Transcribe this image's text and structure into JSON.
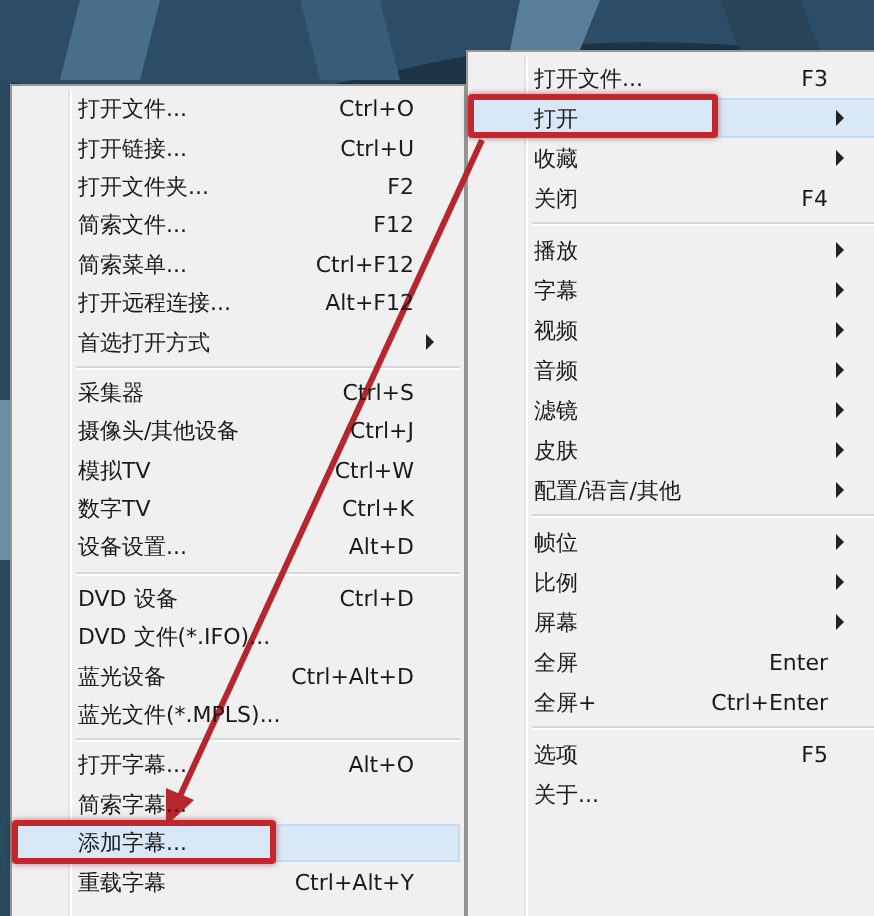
{
  "menus": [
    {
      "kind": "submenu",
      "items": [
        {
          "kind": "item",
          "label": "打开文件...",
          "shortcut": "Ctrl+O",
          "submenu": false,
          "selected": false,
          "annotated": false
        },
        {
          "kind": "item",
          "label": "打开链接...",
          "shortcut": "Ctrl+U",
          "submenu": false,
          "selected": false,
          "annotated": false
        },
        {
          "kind": "item",
          "label": "打开文件夹...",
          "shortcut": "F2",
          "submenu": false,
          "selected": false,
          "annotated": false
        },
        {
          "kind": "item",
          "label": "简索文件...",
          "shortcut": "F12",
          "submenu": false,
          "selected": false,
          "annotated": false
        },
        {
          "kind": "item",
          "label": "简索菜单...",
          "shortcut": "Ctrl+F12",
          "submenu": false,
          "selected": false,
          "annotated": false
        },
        {
          "kind": "item",
          "label": "打开远程连接...",
          "shortcut": "Alt+F12",
          "submenu": false,
          "selected": false,
          "annotated": false
        },
        {
          "kind": "item",
          "label": "首选打开方式",
          "submenu": true,
          "selected": false,
          "annotated": false
        },
        {
          "kind": "separator"
        },
        {
          "kind": "item",
          "label": "采集器",
          "shortcut": "Ctrl+S",
          "submenu": false,
          "selected": false,
          "annotated": false
        },
        {
          "kind": "item",
          "label": "摄像头/其他设备",
          "shortcut": "Ctrl+J",
          "submenu": false,
          "selected": false,
          "annotated": false
        },
        {
          "kind": "item",
          "label": "模拟TV",
          "shortcut": "Ctrl+W",
          "submenu": false,
          "selected": false,
          "annotated": false
        },
        {
          "kind": "item",
          "label": "数字TV",
          "shortcut": "Ctrl+K",
          "submenu": false,
          "selected": false,
          "annotated": false
        },
        {
          "kind": "item",
          "label": "设备设置...",
          "shortcut": "Alt+D",
          "submenu": false,
          "selected": false,
          "annotated": false
        },
        {
          "kind": "separator"
        },
        {
          "kind": "item",
          "label": "DVD 设备",
          "shortcut": "Ctrl+D",
          "submenu": false,
          "selected": false,
          "annotated": false
        },
        {
          "kind": "item",
          "label": "DVD 文件(*.IFO)...",
          "submenu": false,
          "selected": false,
          "annotated": false
        },
        {
          "kind": "item",
          "label": "蓝光设备",
          "shortcut": "Ctrl+Alt+D",
          "submenu": false,
          "selected": false,
          "annotated": false
        },
        {
          "kind": "item",
          "label": "蓝光文件(*.MPLS)...",
          "submenu": false,
          "selected": false,
          "annotated": false
        },
        {
          "kind": "separator"
        },
        {
          "kind": "item",
          "label": "打开字幕...",
          "shortcut": "Alt+O",
          "submenu": false,
          "selected": false,
          "annotated": false
        },
        {
          "kind": "item",
          "label": "简索字幕...",
          "submenu": false,
          "selected": false,
          "annotated": false
        },
        {
          "kind": "item",
          "label": "添加字幕...",
          "submenu": false,
          "selected": true,
          "annotated": true
        },
        {
          "kind": "item",
          "label": "重载字幕",
          "shortcut": "Ctrl+Alt+Y",
          "submenu": false,
          "selected": false,
          "annotated": false
        }
      ]
    },
    {
      "kind": "main",
      "items": [
        {
          "kind": "item",
          "label": "打开文件...",
          "shortcut": "F3",
          "submenu": false,
          "selected": false,
          "annotated": false
        },
        {
          "kind": "item",
          "label": "打开",
          "submenu": true,
          "selected": true,
          "annotated": true
        },
        {
          "kind": "item",
          "label": "收藏",
          "submenu": true,
          "selected": false,
          "annotated": false
        },
        {
          "kind": "item",
          "label": "关闭",
          "shortcut": "F4",
          "submenu": false,
          "selected": false,
          "annotated": false
        },
        {
          "kind": "separator"
        },
        {
          "kind": "item",
          "label": "播放",
          "submenu": true,
          "selected": false,
          "annotated": false
        },
        {
          "kind": "item",
          "label": "字幕",
          "submenu": true,
          "selected": false,
          "annotated": false
        },
        {
          "kind": "item",
          "label": "视频",
          "submenu": true,
          "selected": false,
          "annotated": false
        },
        {
          "kind": "item",
          "label": "音频",
          "submenu": true,
          "selected": false,
          "annotated": false
        },
        {
          "kind": "item",
          "label": "滤镜",
          "submenu": true,
          "selected": false,
          "annotated": false
        },
        {
          "kind": "item",
          "label": "皮肤",
          "submenu": true,
          "selected": false,
          "annotated": false
        },
        {
          "kind": "item",
          "label": "配置/语言/其他",
          "submenu": true,
          "selected": false,
          "annotated": false
        },
        {
          "kind": "separator"
        },
        {
          "kind": "item",
          "label": "帧位",
          "submenu": true,
          "selected": false,
          "annotated": false
        },
        {
          "kind": "item",
          "label": "比例",
          "submenu": true,
          "selected": false,
          "annotated": false
        },
        {
          "kind": "item",
          "label": "屏幕",
          "submenu": true,
          "selected": false,
          "annotated": false
        },
        {
          "kind": "item",
          "label": "全屏",
          "shortcut": "Enter",
          "submenu": false,
          "selected": false,
          "annotated": false
        },
        {
          "kind": "item",
          "label": "全屏+",
          "shortcut": "Ctrl+Enter",
          "submenu": false,
          "selected": false,
          "annotated": false
        },
        {
          "kind": "separator"
        },
        {
          "kind": "item",
          "label": "选项",
          "shortcut": "F5",
          "submenu": false,
          "selected": false,
          "annotated": false
        },
        {
          "kind": "item",
          "label": "关于...",
          "submenu": false,
          "selected": false,
          "annotated": false
        }
      ]
    }
  ]
}
